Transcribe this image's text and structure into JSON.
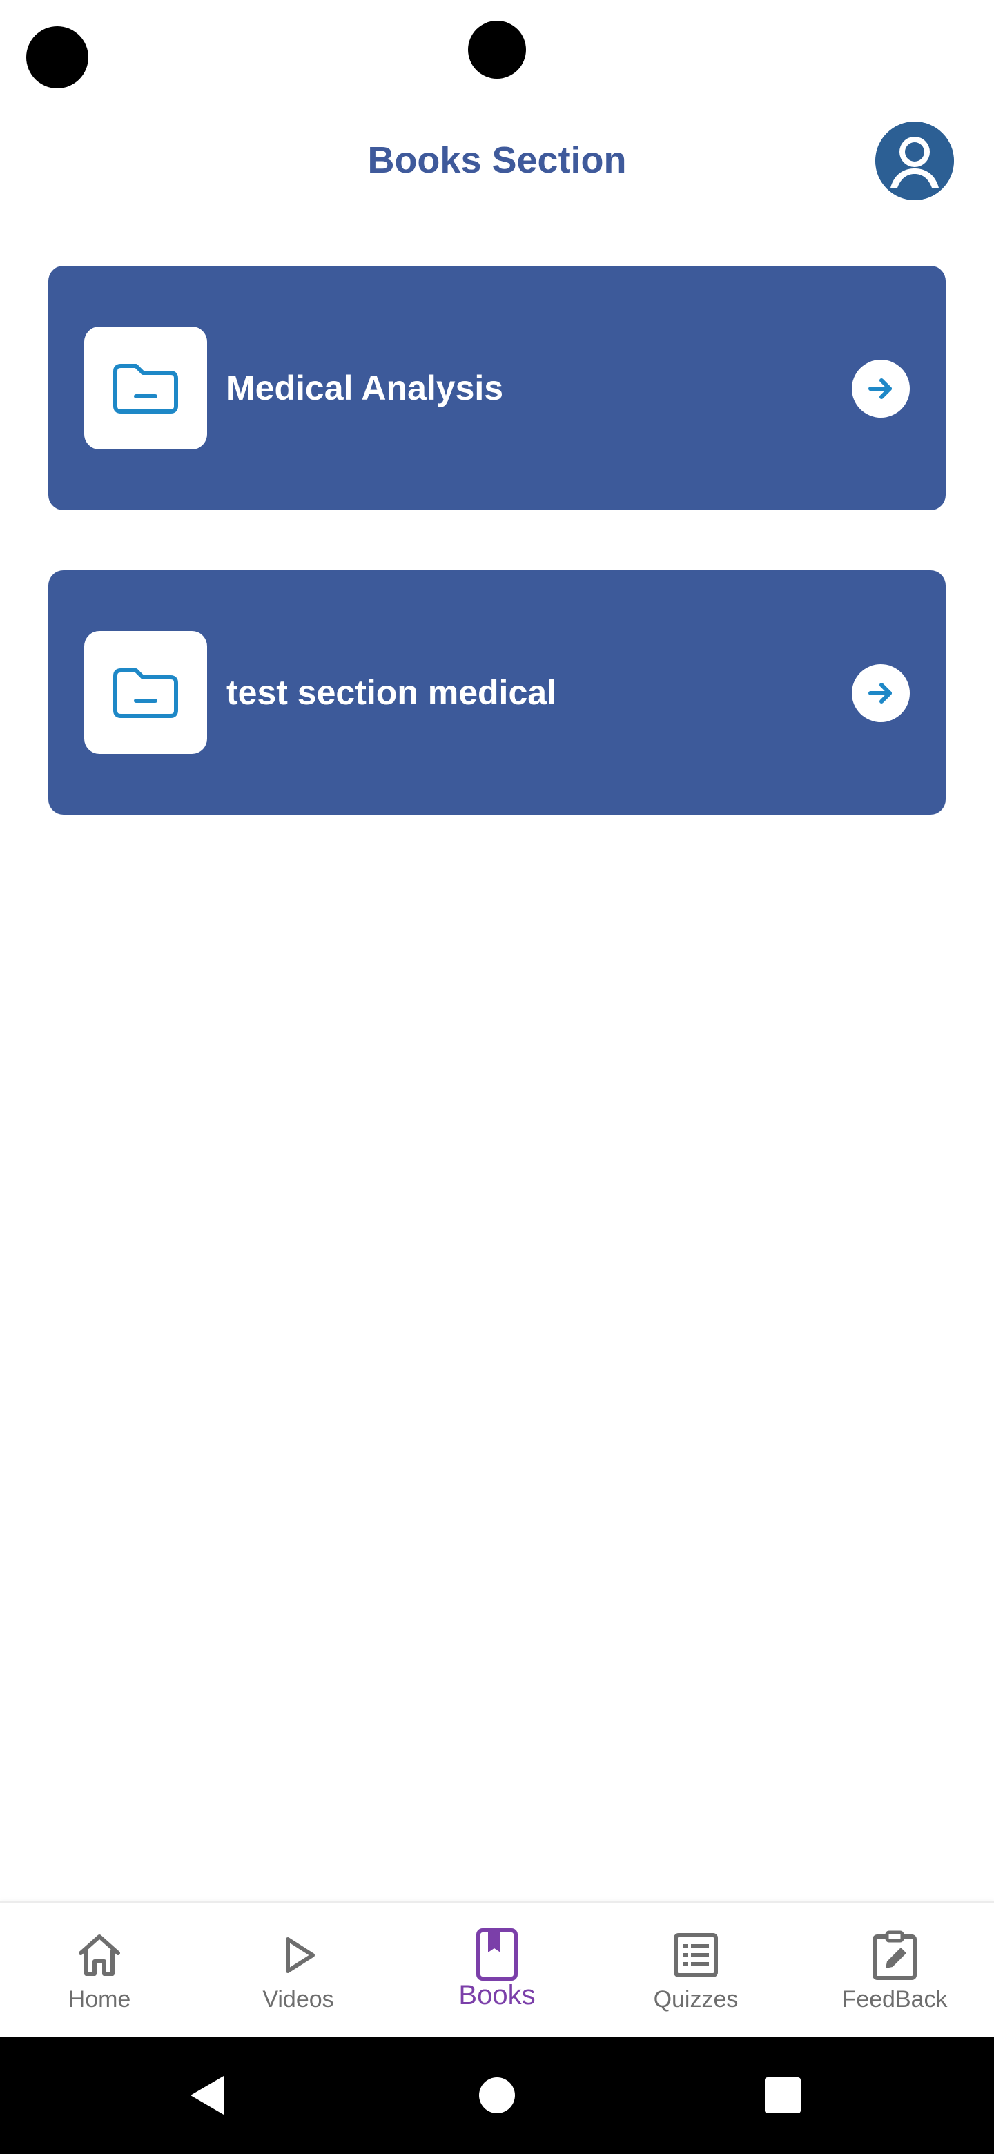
{
  "header": {
    "title": "Books Section",
    "profile_icon": "user-avatar-icon"
  },
  "sections": [
    {
      "label": "Medical Analysis",
      "icon": "folder-icon",
      "action_icon": "arrow-right-circle-icon"
    },
    {
      "label": "test section medical",
      "icon": "folder-icon",
      "action_icon": "arrow-right-circle-icon"
    }
  ],
  "bottom_nav": {
    "items": [
      {
        "label": "Home",
        "icon": "home-icon",
        "active": false
      },
      {
        "label": "Videos",
        "icon": "play-icon",
        "active": false
      },
      {
        "label": "Books",
        "icon": "book-icon",
        "active": true
      },
      {
        "label": "Quizzes",
        "icon": "list-icon",
        "active": false
      },
      {
        "label": "FeedBack",
        "icon": "edit-clipboard-icon",
        "active": false
      }
    ]
  },
  "system_nav": {
    "back": "back-icon",
    "home": "home-circle-icon",
    "recents": "recents-square-icon"
  },
  "colors": {
    "primary": "#3d5a9a",
    "title": "#3f5a9b",
    "avatar": "#2c5f94",
    "icon_accent": "#1e88c7",
    "active_nav": "#7b3fa9",
    "inactive_nav": "#6e6e6e"
  }
}
